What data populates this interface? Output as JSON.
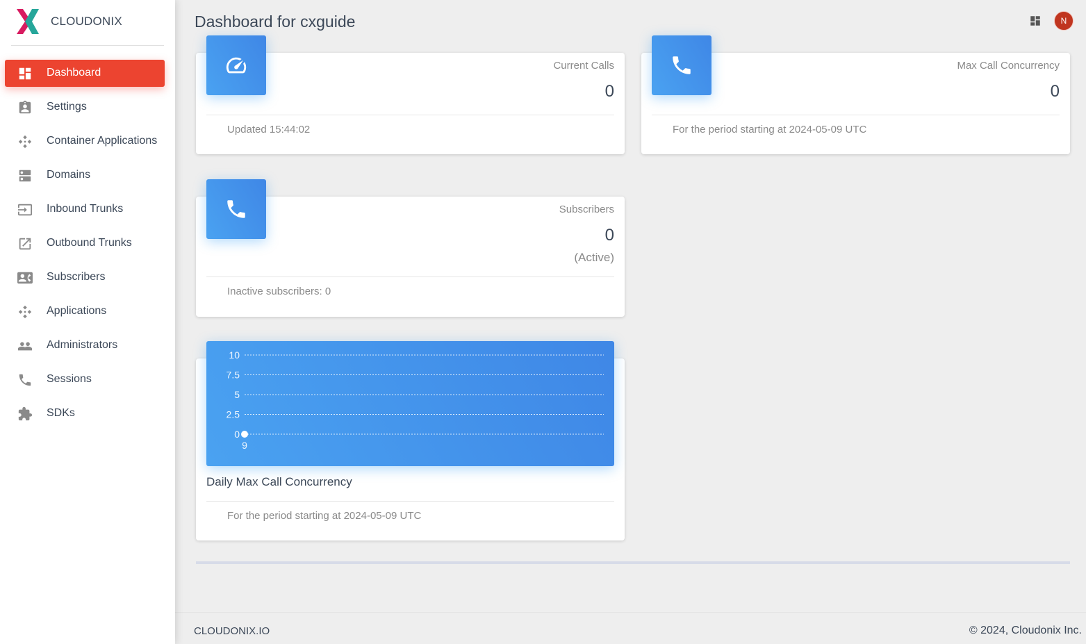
{
  "brand": {
    "name": "CLOUDONIX"
  },
  "nav": {
    "items": [
      {
        "label": "Dashboard",
        "icon": "dashboard-icon",
        "active": true
      },
      {
        "label": "Settings",
        "icon": "assignment-icon"
      },
      {
        "label": "Container Applications",
        "icon": "apps-icon"
      },
      {
        "label": "Domains",
        "icon": "dns-icon"
      },
      {
        "label": "Inbound Trunks",
        "icon": "input-icon"
      },
      {
        "label": "Outbound Trunks",
        "icon": "open-in-new-icon"
      },
      {
        "label": "Subscribers",
        "icon": "contacts-icon"
      },
      {
        "label": "Applications",
        "icon": "apps-icon"
      },
      {
        "label": "Administrators",
        "icon": "people-icon"
      },
      {
        "label": "Sessions",
        "icon": "phone-icon"
      },
      {
        "label": "SDKs",
        "icon": "extension-icon"
      }
    ]
  },
  "header": {
    "title": "Dashboard for cxguide",
    "avatar_initial": "N"
  },
  "cards": {
    "current_calls": {
      "category": "Current Calls",
      "value": "0",
      "footer": "Updated 15:44:02",
      "icon": "speed-icon"
    },
    "max_concurrency": {
      "category": "Max Call Concurrency",
      "value": "0",
      "footer": "For the period starting at 2024-05-09 UTC",
      "icon": "phone-icon"
    },
    "subscribers": {
      "category": "Subscribers",
      "value": "0",
      "sub": "(Active)",
      "footer": "Inactive subscribers: 0",
      "icon": "phone-icon"
    },
    "daily_chart": {
      "title": "Daily Max Call Concurrency",
      "footer": "For the period starting at 2024-05-09 UTC"
    }
  },
  "chart_data": {
    "type": "line",
    "title": "Daily Max Call Concurrency",
    "x": [
      "9"
    ],
    "series": [
      {
        "values": [
          0
        ]
      }
    ],
    "yticks": [
      "0",
      "2.5",
      "5",
      "7.5",
      "10"
    ],
    "ylim": [
      0,
      10
    ],
    "grid": true
  },
  "footer": {
    "left": "CLOUDONIX.IO",
    "right": "© 2024, Cloudonix Inc."
  },
  "colors": {
    "accent": "#ec4430",
    "card_icon": "#4aa2f1",
    "avatar": "#c0351f"
  }
}
